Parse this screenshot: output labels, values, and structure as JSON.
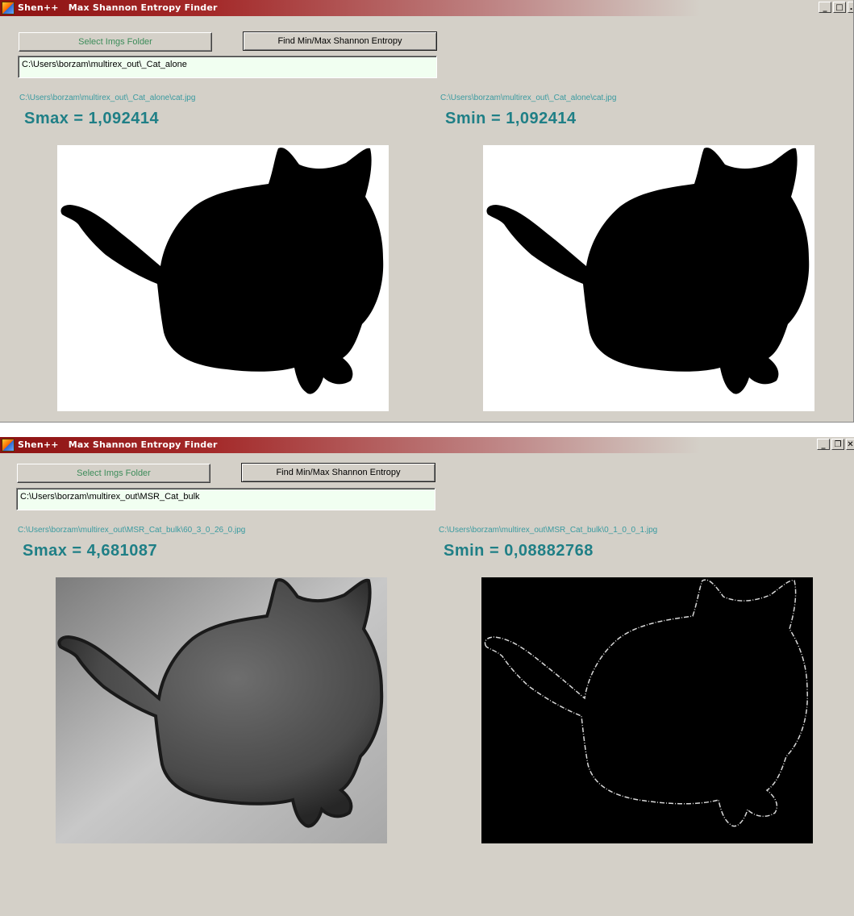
{
  "windows": [
    {
      "title": "Shen++   Max Shannon Entropy Finder",
      "controls": [
        "_",
        "□",
        "."
      ],
      "select_button": "Select Imgs Folder",
      "find_button": "Find Min/Max Shannon Entropy",
      "folder_path": "C:\\Users\\borzam\\multirex_out\\_Cat_alone",
      "left": {
        "file_path": "C:\\Users\\borzam\\multirex_out\\_Cat_alone\\cat.jpg",
        "entropy": "Smax = 1,092414",
        "image_style": "black-silhouette"
      },
      "right": {
        "file_path": "C:\\Users\\borzam\\multirex_out\\_Cat_alone\\cat.jpg",
        "entropy": "Smin = 1,092414",
        "image_style": "black-silhouette"
      }
    },
    {
      "title": "Shen++   Max Shannon Entropy Finder",
      "controls": [
        "_",
        "❐",
        "✕"
      ],
      "select_button": "Select Imgs Folder",
      "find_button": "Find Min/Max Shannon Entropy",
      "folder_path": "C:\\Users\\borzam\\multirex_out\\MSR_Cat_bulk",
      "left": {
        "file_path": "C:\\Users\\borzam\\multirex_out\\MSR_Cat_bulk\\60_3_0_26_0.jpg",
        "entropy": "Smax = 4,681087",
        "image_style": "gray-gradient"
      },
      "right": {
        "file_path": "C:\\Users\\borzam\\multirex_out\\MSR_Cat_bulk\\0_1_0_0_1.jpg",
        "entropy": "Smin = 0,08882768",
        "image_style": "edge-outline"
      }
    }
  ],
  "colors": {
    "window_bg": "#d4d0c8",
    "titlebar_start": "#8e1212",
    "entropy_text": "#1f7f86",
    "path_text": "#3a9aa0",
    "select_text": "#3d8c5a",
    "input_bg": "#f1fff1"
  }
}
